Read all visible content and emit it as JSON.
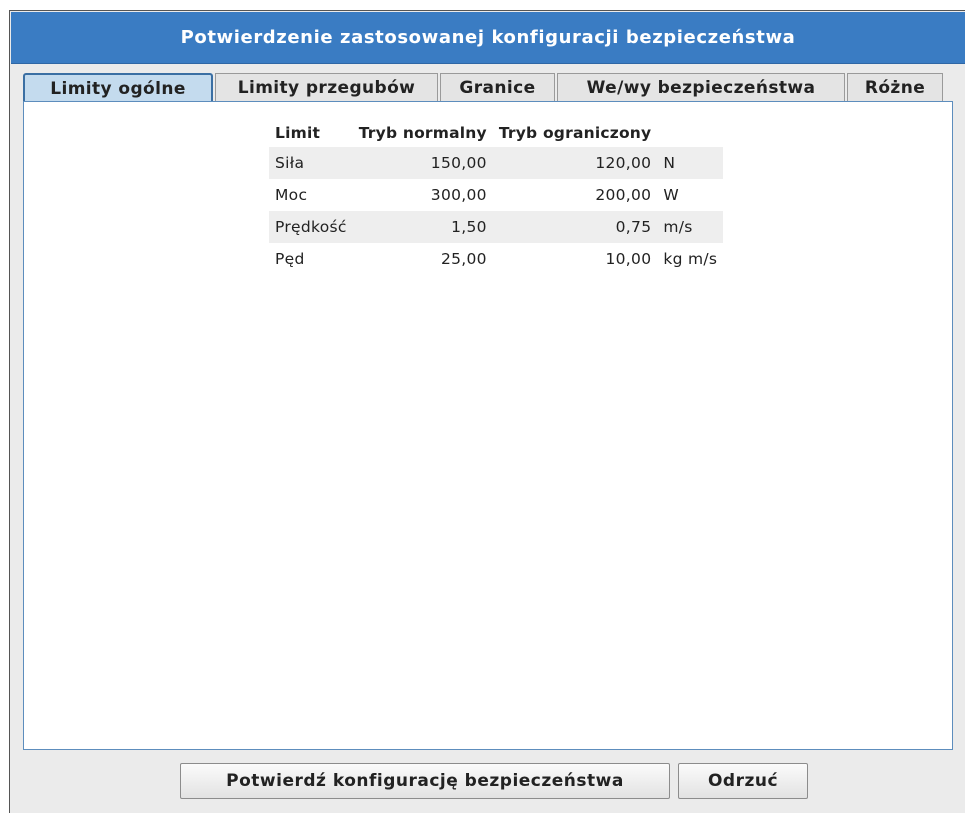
{
  "dialog": {
    "title": "Potwierdzenie zastosowanej konfiguracji bezpieczeństwa"
  },
  "tabs": [
    {
      "label": "Limity ogólne",
      "active": true
    },
    {
      "label": "Limity przegubów",
      "active": false
    },
    {
      "label": "Granice",
      "active": false
    },
    {
      "label": "We/wy bezpieczeństwa",
      "active": false
    },
    {
      "label": "Różne",
      "active": false
    }
  ],
  "table": {
    "headers": [
      "Limit",
      "Tryb normalny",
      "Tryb ograniczony",
      ""
    ],
    "rows": [
      [
        "Siła",
        "150,00",
        "120,00",
        "N"
      ],
      [
        "Moc",
        "300,00",
        "200,00",
        "W"
      ],
      [
        "Prędkość",
        "1,50",
        "0,75",
        "m/s"
      ],
      [
        "Pęd",
        "25,00",
        "10,00",
        "kg m/s"
      ]
    ]
  },
  "buttons": {
    "confirm": "Potwierdź konfigurację bezpieczeństwa",
    "reject": "Odrzuć"
  },
  "colors": {
    "titlebar": "#3a7cc3",
    "active_tab": "#c4dbee",
    "panel_border": "#5d8dbd"
  }
}
